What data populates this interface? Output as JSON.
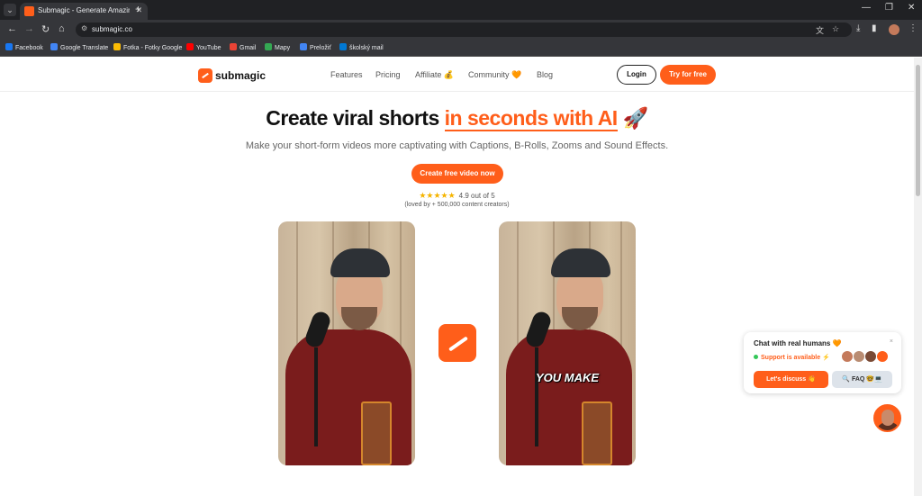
{
  "browser": {
    "tab_title": "Submagic - Generate Amazing",
    "url": "submagic.co",
    "bookmarks": [
      "Facebook",
      "Google Translate",
      "Fotka - Fotky Google",
      "YouTube",
      "Gmail",
      "Mapy",
      "Preložiť",
      "školský mail"
    ]
  },
  "nav": {
    "brand": "submagic",
    "links": [
      "Features",
      "Pricing",
      "Affiliate 💰",
      "Community 🧡",
      "Blog"
    ],
    "login": "Login",
    "try": "Try for free"
  },
  "hero": {
    "title_before": "Create viral shorts ",
    "title_accent": "in seconds with AI",
    "title_after": " 🚀",
    "subtitle": "Make your short-form videos more captivating with Captions, B-Rolls, Zooms and Sound Effects.",
    "cta": "Create free video now",
    "stars": "★★★★★",
    "rating": "4.9 out of 5",
    "loved": "(loved by + 500,000 content creators)"
  },
  "videos": {
    "caption": "YOU MAKE"
  },
  "chat": {
    "title": "Chat with real humans 🧡",
    "close": "×",
    "status": "Support is available ⚡",
    "discuss": "Let's discuss 👋",
    "faq": "🔍 FAQ 🤓💻"
  },
  "colors": {
    "accent": "#ff5e1a"
  }
}
